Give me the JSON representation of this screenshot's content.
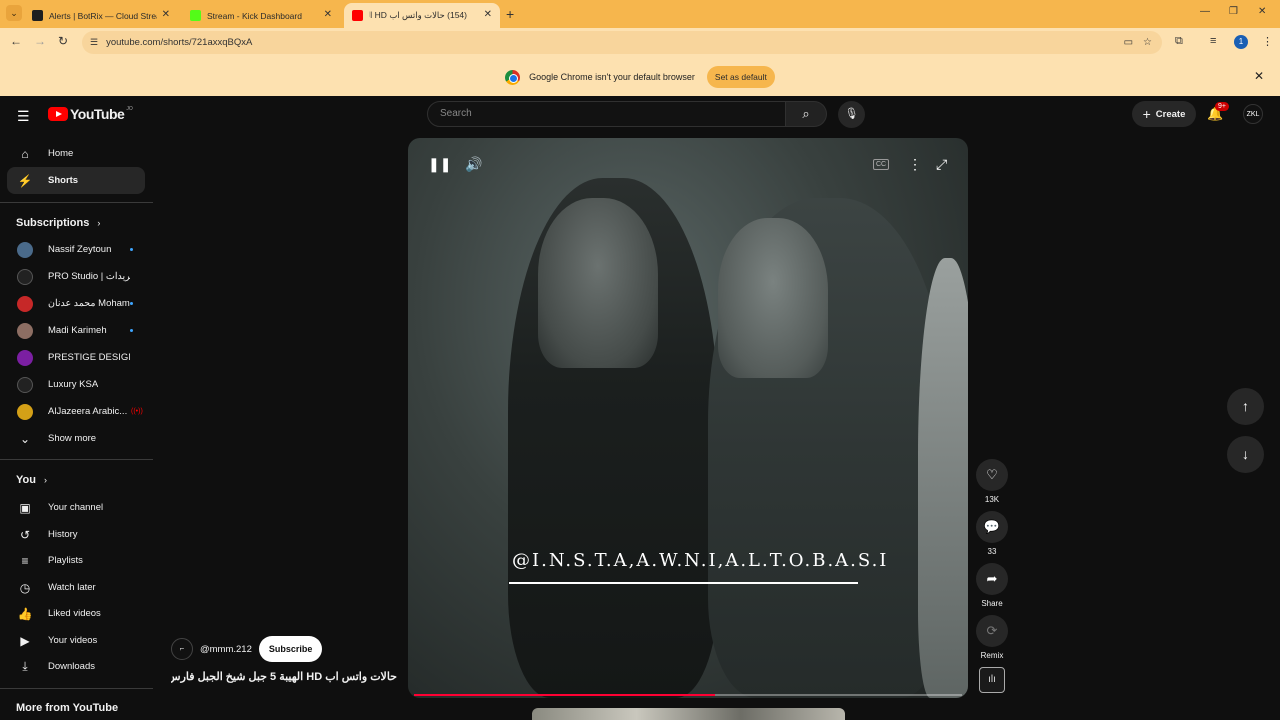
{
  "browser": {
    "tabs": [
      {
        "title": "Alerts | BotRix — Cloud Streaming",
        "fav_color": "#1f1f1f"
      },
      {
        "title": "Stream - Kick Dashboard",
        "fav_color": "#53fc18"
      },
      {
        "title": "(154) حالات واتس اب HD الهيبة",
        "fav_color": "#ff0000"
      }
    ],
    "url": "youtube.com/shorts/721axxqBQxA",
    "profile_initial": "1"
  },
  "banner": {
    "message": "Google Chrome isn't your default browser",
    "button": "Set as default"
  },
  "header": {
    "logo_text": "YouTube",
    "country": "JO",
    "search_placeholder": "Search",
    "create_label": "Create",
    "notification_count": "9+",
    "avatar_text": "ZKL"
  },
  "sidebar": {
    "main": [
      {
        "label": "Home",
        "icon": "home-icon"
      },
      {
        "label": "Shorts",
        "icon": "shorts-icon"
      }
    ],
    "subscriptions_title": "Subscriptions",
    "subscriptions": [
      {
        "label": "Nassif Zeytoun",
        "color": "#4a6a8a"
      },
      {
        "label": "PRO Studio | الريدات",
        "color": "#222222"
      },
      {
        "label": "محمد عدنان Moham...",
        "color": "#c62828"
      },
      {
        "label": "Madi Karimeh",
        "color": "#8d6e63"
      },
      {
        "label": "PRESTIGE DESIGN...",
        "color": "#7b1fa2"
      },
      {
        "label": "Luxury KSA",
        "color": "#222222"
      },
      {
        "label": "AlJazeera Arabic...",
        "color": "#d4a017"
      }
    ],
    "show_more": "Show more",
    "you_title": "You",
    "you_items": [
      {
        "label": "Your channel",
        "icon": "user-icon"
      },
      {
        "label": "History",
        "icon": "history-icon"
      },
      {
        "label": "Playlists",
        "icon": "playlist-icon"
      },
      {
        "label": "Watch later",
        "icon": "clock-icon"
      },
      {
        "label": "Liked videos",
        "icon": "thumbs-up-icon"
      },
      {
        "label": "Your videos",
        "icon": "video-icon"
      },
      {
        "label": "Downloads",
        "icon": "download-icon"
      }
    ],
    "more_title": "More from YouTube"
  },
  "video": {
    "watermark": "@I.N.S.T.A,A.W.N.I,A.L.T.O.B.A.S.I",
    "progress": 0.55,
    "channel_handle": "@mmm.212",
    "subscribe_label": "Subscribe",
    "title": "حالات واتس اب HD الهيبة 5 جبل شيخ الجبل فارس..."
  },
  "actions": {
    "likes": "13K",
    "comments": "33",
    "share": "Share",
    "remix": "Remix"
  }
}
